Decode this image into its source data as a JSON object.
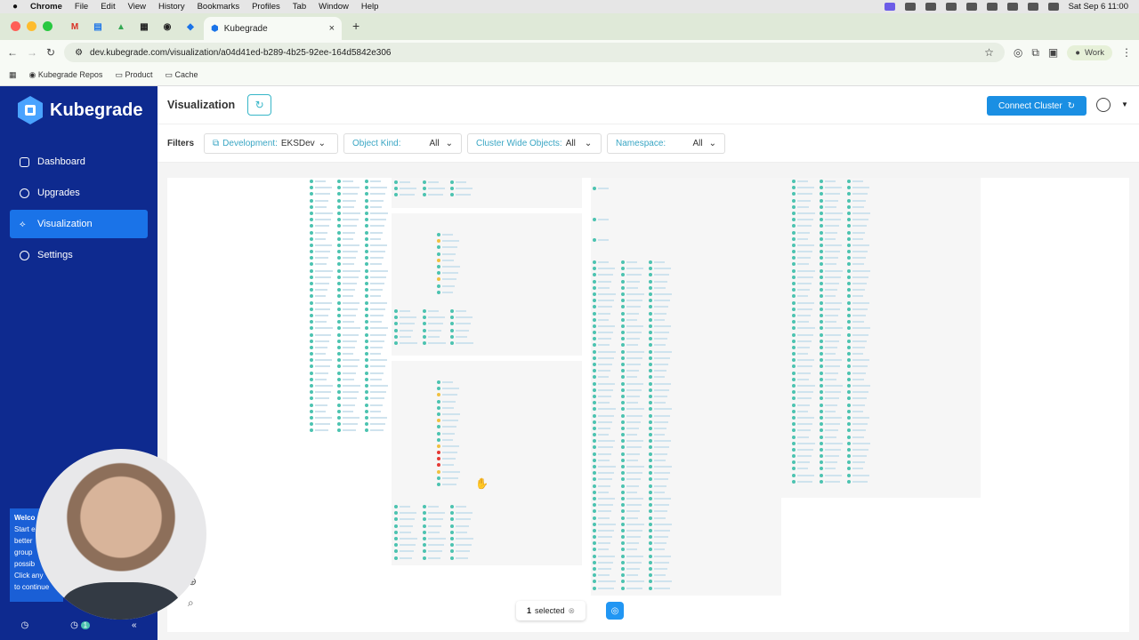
{
  "menubar": {
    "app": "Chrome",
    "items": [
      "File",
      "Edit",
      "View",
      "History",
      "Bookmarks",
      "Profiles",
      "Tab",
      "Window",
      "Help"
    ],
    "clock": "Sat Sep 6  11:00"
  },
  "browser": {
    "tab_title": "Kubegrade",
    "url": "dev.kubegrade.com/visualization/a04d41ed-b289-4b25-92ee-164d5842e306",
    "profile": "Work"
  },
  "bookmarks": [
    "Kubegrade Repos",
    "Product",
    "Cache"
  ],
  "sidebar": {
    "brand": "Kubegrade",
    "items": [
      {
        "label": "Dashboard"
      },
      {
        "label": "Upgrades"
      },
      {
        "label": "Visualization"
      },
      {
        "label": "Settings"
      }
    ],
    "welcome_lines": [
      "Welco",
      "Start e",
      "better",
      "group",
      "possib",
      "",
      "Click any",
      "to continue"
    ],
    "badge": "1",
    "collapse": "«"
  },
  "header": {
    "title": "Visualization",
    "connect_label": "Connect Cluster"
  },
  "filters": {
    "label": "Filters",
    "items": [
      {
        "key": "Development:",
        "value": "EKSDev"
      },
      {
        "key": "Object Kind:",
        "value": "All"
      },
      {
        "key": "Cluster Wide Objects:",
        "value": "All"
      },
      {
        "key": "Namespace:",
        "value": "All"
      }
    ]
  },
  "selection": {
    "count": "1",
    "label": "selected"
  },
  "colors": {
    "sidebar": "#0e2a8f",
    "accent": "#1a73e8",
    "node": "#4cc3b0",
    "warn": "#f0c040",
    "error": "#e53935"
  }
}
